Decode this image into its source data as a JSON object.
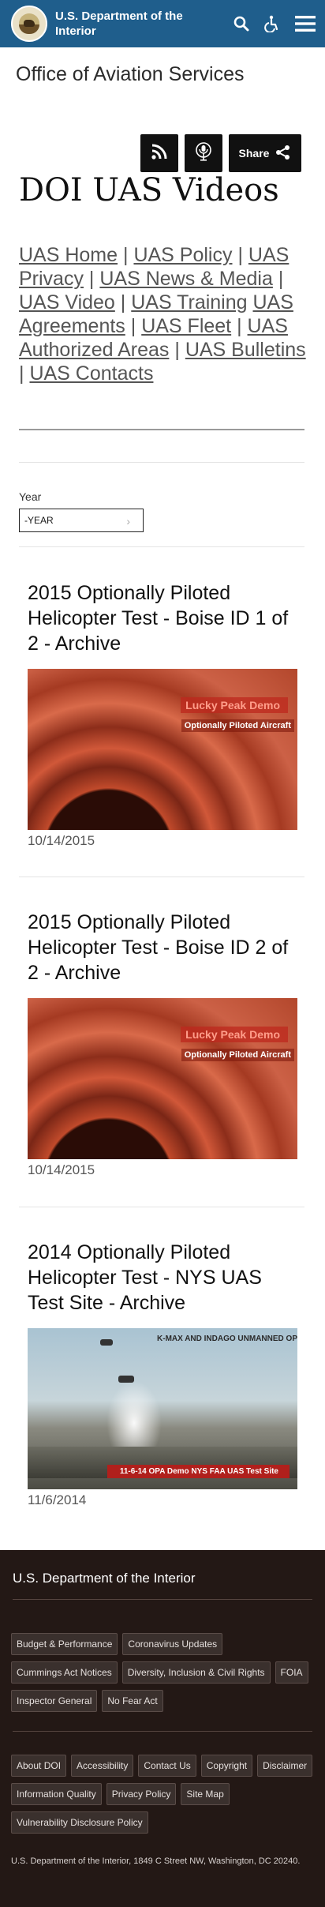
{
  "header": {
    "site_name": "U.S. Department of the Interior",
    "icons": [
      "seal-logo",
      "search-icon",
      "accessibility-icon",
      "menu-icon"
    ],
    "color": "#1f5e8c"
  },
  "office_name": "Office of Aviation Services",
  "share": {
    "rss_icon": "rss-icon",
    "podcast_icon": "podcast-icon",
    "share_label": "Share",
    "share_icon": "share-icon"
  },
  "page_title": "DOI UAS Videos",
  "nav_links": [
    "UAS Home",
    "UAS Policy",
    "UAS Privacy",
    "UAS News & Media",
    "UAS Video",
    "UAS Training",
    "UAS Agreements",
    "UAS Fleet",
    "UAS Authorized Areas",
    "UAS Bulletins",
    "UAS Contacts"
  ],
  "filter": {
    "label": "Year",
    "selected": "-YEAR"
  },
  "videos": [
    {
      "title": "2015 Optionally Piloted Helicopter Test - Boise ID 1 of 2 - Archive",
      "thumb_title": "Lucky Peak Demo",
      "thumb_subtitle": "Optionally Piloted Aircraft",
      "date": "10/14/2015"
    },
    {
      "title": "2015 Optionally Piloted Helicopter Test - Boise ID 2 of 2 - Archive",
      "thumb_title": "Lucky Peak Demo",
      "thumb_subtitle": "Optionally Piloted Aircraft",
      "date": "10/14/2015"
    },
    {
      "title": "2014 Optionally Piloted Helicopter Test - NYS UAS Test Site - Archive",
      "thumb_header": "K-MAX AND INDAGO UNMANNED OP",
      "thumb_banner": "11-6-14 OPA Demo NYS FAA UAS Test Site",
      "date": "11/6/2014"
    }
  ],
  "footer": {
    "title": "U.S. Department of the Interior",
    "group1": [
      "Budget & Performance",
      "Coronavirus Updates",
      "Cummings Act Notices",
      "Diversity, Inclusion & Civil Rights",
      "FOIA",
      "Inspector General",
      "No Fear Act"
    ],
    "group2": [
      "About DOI",
      "Accessibility",
      "Contact Us",
      "Copyright",
      "Disclaimer",
      "Information Quality",
      "Privacy Policy",
      "Site Map",
      "Vulnerability Disclosure Policy"
    ],
    "address": "U.S. Department of the Interior, 1849 C Street NW, Washington, DC 20240.",
    "background": "#231815"
  }
}
